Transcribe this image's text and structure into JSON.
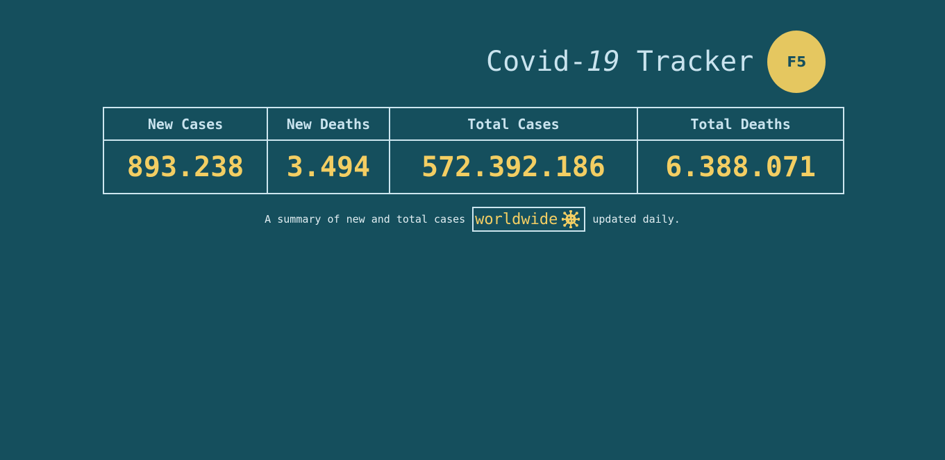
{
  "header": {
    "title_prefix": "Covid-",
    "title_number": "19",
    "title_suffix": " Tracker",
    "refresh_label": "F5"
  },
  "stats": {
    "columns": [
      "New Cases",
      "New Deaths",
      "Total Cases",
      "Total Deaths"
    ],
    "values": [
      "893.238",
      "3.494",
      "572.392.186",
      "6.388.071"
    ]
  },
  "summary": {
    "before": "A summary of new and total cases",
    "region": "worldwide",
    "region_icon": "virus-icon",
    "after": "updated daily."
  },
  "colors": {
    "background": "#154f5d",
    "accent": "#f3ce63",
    "button": "#e5c760",
    "text": "#cde6ef"
  }
}
